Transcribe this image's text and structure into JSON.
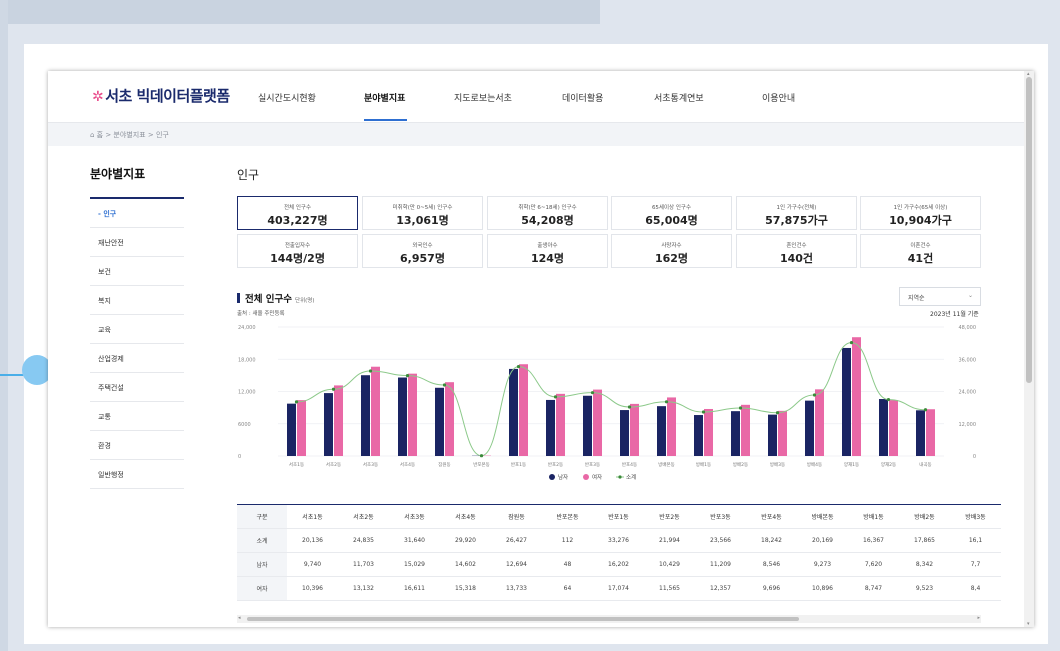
{
  "brand": {
    "logo_text": "서초 빅데이터플랫폼"
  },
  "nav": [
    "실시간도시현황",
    "분야별지표",
    "지도로보는서초",
    "데이터활용",
    "서초통계연보",
    "이용안내"
  ],
  "breadcrumb": "⌂ 홈 > 분야별지표 > 인구",
  "sidebar": {
    "title": "분야별지표",
    "items": [
      "- 인구",
      "재난안전",
      "보건",
      "복지",
      "교육",
      "산업경제",
      "주택건설",
      "교통",
      "환경",
      "일반행정"
    ]
  },
  "content": {
    "title": "인구"
  },
  "stats": [
    {
      "label": "전체 인구수",
      "value": "403,227명"
    },
    {
      "label": "미취학(만 0~5세) 인구수",
      "value": "13,061명"
    },
    {
      "label": "취학(만 6~18세) 인구수",
      "value": "54,208명"
    },
    {
      "label": "65세이상 인구수",
      "value": "65,004명"
    },
    {
      "label": "1인 가구수(전체)",
      "value": "57,875가구"
    },
    {
      "label": "1인 가구수(65세 이상)",
      "value": "10,904가구"
    },
    {
      "label": "전출입자수",
      "value": "144명/2명"
    },
    {
      "label": "외국인수",
      "value": "6,957명"
    },
    {
      "label": "출생아수",
      "value": "124명"
    },
    {
      "label": "사망자수",
      "value": "162명"
    },
    {
      "label": "혼인건수",
      "value": "140건"
    },
    {
      "label": "이혼건수",
      "value": "41건"
    }
  ],
  "chart_section": {
    "title": "전체 인구수",
    "unit": "단위(명)",
    "source": "출처 : 새올 주민등록",
    "date": "2023년 11월 기준",
    "sort_value": "지역순",
    "sort_icon": "chevron-down-icon"
  },
  "colors": {
    "male": "#1a2463",
    "female": "#e968a6",
    "total": "#8cc98a",
    "accent": "#2e6fd1"
  },
  "chart_data": {
    "type": "bar",
    "categories": [
      "서초1동",
      "서초2동",
      "서초3동",
      "서초4동",
      "잠원동",
      "반포본동",
      "반포1동",
      "반포2동",
      "반포3동",
      "반포4동",
      "방배본동",
      "방배1동",
      "방배2동",
      "방배3동",
      "방배4동",
      "양재1동",
      "양재2동",
      "내곡동"
    ],
    "series": [
      {
        "name": "남자",
        "values": [
          9740,
          11703,
          15029,
          14602,
          12694,
          48,
          16202,
          10429,
          11209,
          8546,
          9273,
          7620,
          8342,
          7700,
          10300,
          20100,
          10600,
          8500
        ]
      },
      {
        "name": "여자",
        "values": [
          10396,
          13132,
          16611,
          15318,
          13733,
          64,
          17074,
          11565,
          12357,
          9696,
          10896,
          8747,
          9523,
          8400,
          12400,
          22100,
          10400,
          8700
        ]
      },
      {
        "name": "소계",
        "values": [
          20136,
          24835,
          31640,
          29920,
          26427,
          112,
          33276,
          21994,
          23566,
          18242,
          20169,
          16367,
          17865,
          16100,
          22700,
          42200,
          21000,
          17200
        ]
      }
    ],
    "y_left_ticks": [
      "24,000",
      "18,000",
      "12,000",
      "6000",
      "0"
    ],
    "y_right_ticks": [
      "48,000",
      "36,000",
      "24,000",
      "12,000",
      "0"
    ],
    "ylim_left": [
      0,
      24000
    ],
    "ylim_right": [
      0,
      48000
    ],
    "legend_position": "bottom"
  },
  "table": {
    "headers": [
      "구분",
      "서초1동",
      "서초2동",
      "서초3동",
      "서초4동",
      "잠원동",
      "반포본동",
      "반포1동",
      "반포2동",
      "반포3동",
      "반포4동",
      "방배본동",
      "방배1동",
      "방배2동",
      "방배3동"
    ],
    "rows": [
      [
        "소계",
        "20,136",
        "24,835",
        "31,640",
        "29,920",
        "26,427",
        "112",
        "33,276",
        "21,994",
        "23,566",
        "18,242",
        "20,169",
        "16,367",
        "17,865",
        "16,1"
      ],
      [
        "남자",
        "9,740",
        "11,703",
        "15,029",
        "14,602",
        "12,694",
        "48",
        "16,202",
        "10,429",
        "11,209",
        "8,546",
        "9,273",
        "7,620",
        "8,342",
        "7,7"
      ],
      [
        "여자",
        "10,396",
        "13,132",
        "16,611",
        "15,318",
        "13,733",
        "64",
        "17,074",
        "11,565",
        "12,357",
        "9,696",
        "10,896",
        "8,747",
        "9,523",
        "8,4"
      ]
    ]
  },
  "scrollbar_arrows": {
    "left": "◂",
    "right": "▸",
    "up": "▴",
    "down": "▾"
  }
}
